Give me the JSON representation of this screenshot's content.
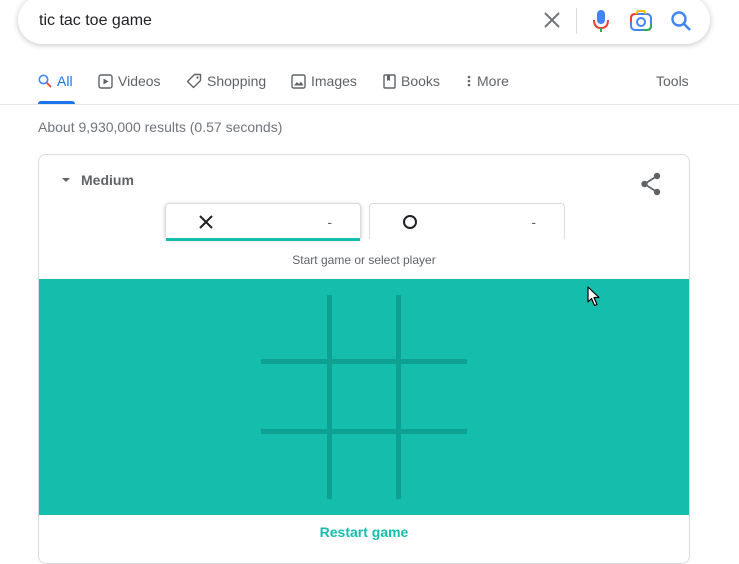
{
  "search": {
    "query": "tic tac toe game"
  },
  "tabs": [
    {
      "label": "All",
      "icon": "search-icon",
      "active": true
    },
    {
      "label": "Videos",
      "icon": "video-icon"
    },
    {
      "label": "Shopping",
      "icon": "tag-icon"
    },
    {
      "label": "Images",
      "icon": "image-icon"
    },
    {
      "label": "Books",
      "icon": "book-icon"
    },
    {
      "label": "More",
      "icon": "more-vert-icon"
    }
  ],
  "tools_label": "Tools",
  "result_stats": "About 9,930,000 results (0.57 seconds)",
  "game": {
    "difficulty": "Medium",
    "players": [
      {
        "mark": "X",
        "score": "-"
      },
      {
        "mark": "O",
        "score": "-"
      }
    ],
    "status": "Start game or select player",
    "restart_label": "Restart game"
  },
  "colors": {
    "accent_blue": "#1a73e8",
    "board_teal": "#14bdac",
    "grid_line": "#0da192"
  }
}
